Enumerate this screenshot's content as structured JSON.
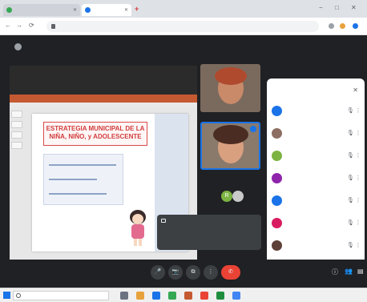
{
  "browser": {
    "tabs": [
      {
        "title": "",
        "favicon_color": "#34a853"
      },
      {
        "title": "",
        "favicon_color": "#1a73e8"
      }
    ],
    "new_tab": "+",
    "window_controls": {
      "minimize": "−",
      "maximize": "□",
      "close": "✕"
    },
    "url": "",
    "nav": {
      "back": "←",
      "forward": "→",
      "reload": "⟳"
    }
  },
  "meet": {
    "presenter_text": "",
    "slide": {
      "title": "ESTRATEGIA MUNICIPAL DE LA NIÑA, NIÑO, y ADOLESCENTE"
    },
    "tile3_initial": "R",
    "chat_toast": {
      "sender": "",
      "message": ""
    },
    "people_panel": {
      "title": "",
      "close": "✕",
      "people": [
        {
          "name": "",
          "avatar_color": "#1a73e8"
        },
        {
          "name": "",
          "avatar_color": "#8d6e63"
        },
        {
          "name": "",
          "avatar_color": "#7cb342"
        },
        {
          "name": "",
          "avatar_color": "#8e24aa"
        },
        {
          "name": "",
          "avatar_color": "#1a73e8"
        },
        {
          "name": "",
          "avatar_color": "#d81b60"
        },
        {
          "name": "",
          "avatar_color": "#5d4037"
        },
        {
          "name": "",
          "avatar_color": "#43a047"
        }
      ]
    },
    "callbar": {
      "meeting_info": "",
      "buttons": [
        "🎤",
        "📷",
        "⧉",
        "⋮",
        "✆"
      ]
    }
  },
  "taskbar": {
    "search_placeholder": "",
    "tray_text": ""
  },
  "colors": {
    "meet_bg": "#202124",
    "end_call": "#ea4335",
    "accent": "#1a73e8",
    "slide_title": "#d23c3c"
  }
}
